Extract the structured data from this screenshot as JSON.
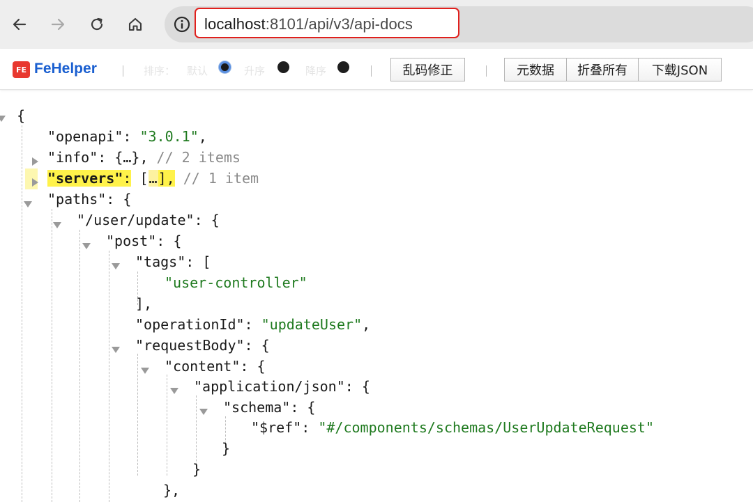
{
  "browser": {
    "url_host": "localhost",
    "url_path": ":8101/api/v3/api-docs"
  },
  "toolbar": {
    "logo_text": "FE",
    "title": "FeHelper",
    "faded_1": "排序：",
    "faded_2": "默认",
    "faded_3": "升序",
    "faded_4": "降序",
    "fix_encoding": "乱码修正",
    "metadata": "元数据",
    "collapse_all": "折叠所有",
    "download_json": "下载JSON"
  },
  "json_lines": {
    "l0": "{",
    "l1_key": "\"openapi\"",
    "l1_val": "\"3.0.1\"",
    "l2_key": "\"info\"",
    "l2_comment": "// 2 items",
    "l3_key": "\"servers\"",
    "l3_comment": "// 1 item",
    "l4_key": "\"paths\"",
    "l5_key": "\"/user/update\"",
    "l6_key": "\"post\"",
    "l7_key": "\"tags\"",
    "l8_val": "\"user-controller\"",
    "l9": "],",
    "l10_key": "\"operationId\"",
    "l10_val": "\"updateUser\"",
    "l11_key": "\"requestBody\"",
    "l12_key": "\"content\"",
    "l13_key": "\"application/json\"",
    "l14_key": "\"schema\"",
    "l15_key": "\"$ref\"",
    "l15_val": "\"#/components/schemas/UserUpdateRequest\"",
    "l16": "}",
    "l17": "}",
    "l18": "},"
  },
  "colors": {
    "url_highlight_border": "#e0201d",
    "string_value": "#1f7a1f",
    "comment": "#8a8a8a",
    "highlight": "#fff24a",
    "brand": "#1a5fd0"
  }
}
